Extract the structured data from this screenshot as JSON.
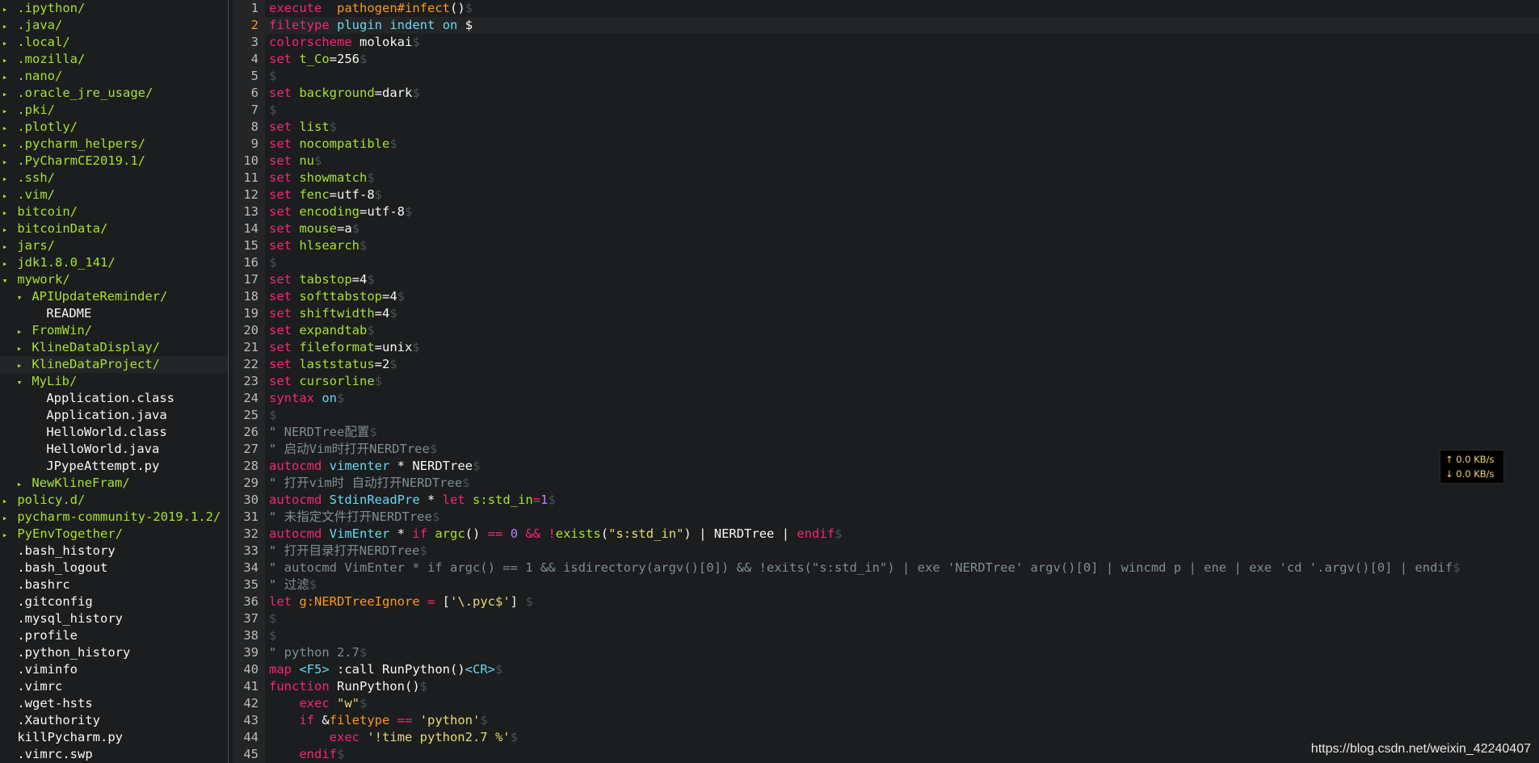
{
  "tree": {
    "current_index": 21,
    "items": [
      {
        "indent": 0,
        "arrow": "▸",
        "name": ".ipython",
        "slash": "/",
        "dir": true
      },
      {
        "indent": 0,
        "arrow": "▸",
        "name": ".java",
        "slash": "/",
        "dir": true
      },
      {
        "indent": 0,
        "arrow": "▸",
        "name": ".local",
        "slash": "/",
        "dir": true
      },
      {
        "indent": 0,
        "arrow": "▸",
        "name": ".mozilla",
        "slash": "/",
        "dir": true
      },
      {
        "indent": 0,
        "arrow": "▸",
        "name": ".nano",
        "slash": "/",
        "dir": true
      },
      {
        "indent": 0,
        "arrow": "▸",
        "name": ".oracle_jre_usage",
        "slash": "/",
        "dir": true
      },
      {
        "indent": 0,
        "arrow": "▸",
        "name": ".pki",
        "slash": "/",
        "dir": true
      },
      {
        "indent": 0,
        "arrow": "▸",
        "name": ".plotly",
        "slash": "/",
        "dir": true
      },
      {
        "indent": 0,
        "arrow": "▸",
        "name": ".pycharm_helpers",
        "slash": "/",
        "dir": true
      },
      {
        "indent": 0,
        "arrow": "▸",
        "name": ".PyCharmCE2019.1",
        "slash": "/",
        "dir": true
      },
      {
        "indent": 0,
        "arrow": "▸",
        "name": ".ssh",
        "slash": "/",
        "dir": true
      },
      {
        "indent": 0,
        "arrow": "▸",
        "name": ".vim",
        "slash": "/",
        "dir": true
      },
      {
        "indent": 0,
        "arrow": "▸",
        "name": "bitcoin",
        "slash": "/",
        "dir": true
      },
      {
        "indent": 0,
        "arrow": "▸",
        "name": "bitcoinData",
        "slash": "/",
        "dir": true
      },
      {
        "indent": 0,
        "arrow": "▸",
        "name": "jars",
        "slash": "/",
        "dir": true
      },
      {
        "indent": 0,
        "arrow": "▸",
        "name": "jdk1.8.0_141",
        "slash": "/",
        "dir": true
      },
      {
        "indent": 0,
        "arrow": "▾",
        "name": "mywork",
        "slash": "/",
        "dir": true
      },
      {
        "indent": 1,
        "arrow": "▾",
        "name": "APIUpdateReminder",
        "slash": "/",
        "dir": true
      },
      {
        "indent": 2,
        "arrow": "",
        "name": "README",
        "slash": "",
        "dir": false
      },
      {
        "indent": 1,
        "arrow": "▸",
        "name": "FromWin",
        "slash": "/",
        "dir": true
      },
      {
        "indent": 1,
        "arrow": "▸",
        "name": "KlineDataDisplay",
        "slash": "/",
        "dir": true
      },
      {
        "indent": 1,
        "arrow": "▸",
        "name": "KlineDataProject",
        "slash": "/",
        "dir": true
      },
      {
        "indent": 1,
        "arrow": "▾",
        "name": "MyLib",
        "slash": "/",
        "dir": true
      },
      {
        "indent": 2,
        "arrow": "",
        "name": "Application.class",
        "slash": "",
        "dir": false
      },
      {
        "indent": 2,
        "arrow": "",
        "name": "Application.java",
        "slash": "",
        "dir": false
      },
      {
        "indent": 2,
        "arrow": "",
        "name": "HelloWorld.class",
        "slash": "",
        "dir": false
      },
      {
        "indent": 2,
        "arrow": "",
        "name": "HelloWorld.java",
        "slash": "",
        "dir": false
      },
      {
        "indent": 2,
        "arrow": "",
        "name": "JPypeAttempt.py",
        "slash": "",
        "dir": false
      },
      {
        "indent": 1,
        "arrow": "▸",
        "name": "NewKlineFram",
        "slash": "/",
        "dir": true
      },
      {
        "indent": 0,
        "arrow": "▸",
        "name": "policy.d",
        "slash": "/",
        "dir": true
      },
      {
        "indent": 0,
        "arrow": "▸",
        "name": "pycharm-community-2019.1.2",
        "slash": "/",
        "dir": true
      },
      {
        "indent": 0,
        "arrow": "▸",
        "name": "PyEnvTogether",
        "slash": "/",
        "dir": true
      },
      {
        "indent": 0,
        "arrow": "",
        "name": ".bash_history",
        "slash": "",
        "dir": false
      },
      {
        "indent": 0,
        "arrow": "",
        "name": ".bash_logout",
        "slash": "",
        "dir": false
      },
      {
        "indent": 0,
        "arrow": "",
        "name": ".bashrc",
        "slash": "",
        "dir": false
      },
      {
        "indent": 0,
        "arrow": "",
        "name": ".gitconfig",
        "slash": "",
        "dir": false
      },
      {
        "indent": 0,
        "arrow": "",
        "name": ".mysql_history",
        "slash": "",
        "dir": false
      },
      {
        "indent": 0,
        "arrow": "",
        "name": ".profile",
        "slash": "",
        "dir": false
      },
      {
        "indent": 0,
        "arrow": "",
        "name": ".python_history",
        "slash": "",
        "dir": false
      },
      {
        "indent": 0,
        "arrow": "",
        "name": ".viminfo",
        "slash": "",
        "dir": false
      },
      {
        "indent": 0,
        "arrow": "",
        "name": ".vimrc",
        "slash": "",
        "dir": false
      },
      {
        "indent": 0,
        "arrow": "",
        "name": ".wget-hsts",
        "slash": "",
        "dir": false
      },
      {
        "indent": 0,
        "arrow": "",
        "name": ".Xauthority",
        "slash": "",
        "dir": false
      },
      {
        "indent": 0,
        "arrow": "",
        "name": "killPycharm.py",
        "slash": "",
        "dir": false
      },
      {
        "indent": 0,
        "arrow": "",
        "name": ".vimrc.swp",
        "slash": "",
        "dir": false
      }
    ]
  },
  "editor": {
    "current_line": 2,
    "lines": [
      [
        [
          "k",
          "execute"
        ],
        [
          "",
          "  "
        ],
        [
          "v",
          "pathogen#infect"
        ],
        [
          "",
          "()"
        ],
        [
          "eol",
          "$"
        ]
      ],
      [
        [
          "k",
          "filetype"
        ],
        [
          "",
          " "
        ],
        [
          "t",
          "plugin"
        ],
        [
          "",
          " "
        ],
        [
          "t",
          "indent"
        ],
        [
          "",
          " "
        ],
        [
          "t",
          "on"
        ],
        [
          "",
          " $"
        ]
      ],
      [
        [
          "k",
          "colorscheme"
        ],
        [
          "",
          " molokai"
        ],
        [
          "eol",
          "$"
        ]
      ],
      [
        [
          "k",
          "set"
        ],
        [
          "",
          " "
        ],
        [
          "g",
          "t_Co"
        ],
        [
          "",
          "=256"
        ],
        [
          "eol",
          "$"
        ]
      ],
      [
        [
          "eol",
          "$"
        ]
      ],
      [
        [
          "k",
          "set"
        ],
        [
          "",
          " "
        ],
        [
          "g",
          "background"
        ],
        [
          "",
          "=dark"
        ],
        [
          "eol",
          "$"
        ]
      ],
      [
        [
          "eol",
          "$"
        ]
      ],
      [
        [
          "k",
          "set"
        ],
        [
          "",
          " "
        ],
        [
          "g",
          "list"
        ],
        [
          "eol",
          "$"
        ]
      ],
      [
        [
          "k",
          "set"
        ],
        [
          "",
          " "
        ],
        [
          "g",
          "nocompatible"
        ],
        [
          "eol",
          "$"
        ]
      ],
      [
        [
          "k",
          "set"
        ],
        [
          "",
          " "
        ],
        [
          "g",
          "nu"
        ],
        [
          "eol",
          "$"
        ]
      ],
      [
        [
          "k",
          "set"
        ],
        [
          "",
          " "
        ],
        [
          "g",
          "showmatch"
        ],
        [
          "eol",
          "$"
        ]
      ],
      [
        [
          "k",
          "set"
        ],
        [
          "",
          " "
        ],
        [
          "g",
          "fenc"
        ],
        [
          "",
          "=utf-8"
        ],
        [
          "eol",
          "$"
        ]
      ],
      [
        [
          "k",
          "set"
        ],
        [
          "",
          " "
        ],
        [
          "g",
          "encoding"
        ],
        [
          "",
          "=utf-8"
        ],
        [
          "eol",
          "$"
        ]
      ],
      [
        [
          "k",
          "set"
        ],
        [
          "",
          " "
        ],
        [
          "g",
          "mouse"
        ],
        [
          "",
          "=a"
        ],
        [
          "eol",
          "$"
        ]
      ],
      [
        [
          "k",
          "set"
        ],
        [
          "",
          " "
        ],
        [
          "g",
          "hlsearch"
        ],
        [
          "eol",
          "$"
        ]
      ],
      [
        [
          "eol",
          "$"
        ]
      ],
      [
        [
          "k",
          "set"
        ],
        [
          "",
          " "
        ],
        [
          "g",
          "tabstop"
        ],
        [
          "",
          "=4"
        ],
        [
          "eol",
          "$"
        ]
      ],
      [
        [
          "k",
          "set"
        ],
        [
          "",
          " "
        ],
        [
          "g",
          "softtabstop"
        ],
        [
          "",
          "=4"
        ],
        [
          "eol",
          "$"
        ]
      ],
      [
        [
          "k",
          "set"
        ],
        [
          "",
          " "
        ],
        [
          "g",
          "shiftwidth"
        ],
        [
          "",
          "=4"
        ],
        [
          "eol",
          "$"
        ]
      ],
      [
        [
          "k",
          "set"
        ],
        [
          "",
          " "
        ],
        [
          "g",
          "expandtab"
        ],
        [
          "eol",
          "$"
        ]
      ],
      [
        [
          "k",
          "set"
        ],
        [
          "",
          " "
        ],
        [
          "g",
          "fileformat"
        ],
        [
          "",
          "=unix"
        ],
        [
          "eol",
          "$"
        ]
      ],
      [
        [
          "k",
          "set"
        ],
        [
          "",
          " "
        ],
        [
          "g",
          "laststatus"
        ],
        [
          "",
          "=2"
        ],
        [
          "eol",
          "$"
        ]
      ],
      [
        [
          "k",
          "set"
        ],
        [
          "",
          " "
        ],
        [
          "g",
          "cursorline"
        ],
        [
          "eol",
          "$"
        ]
      ],
      [
        [
          "k",
          "syntax"
        ],
        [
          "",
          " "
        ],
        [
          "t",
          "on"
        ],
        [
          "eol",
          "$"
        ]
      ],
      [
        [
          "eol",
          "$"
        ]
      ],
      [
        [
          "c",
          "\" NERDTree配置"
        ],
        [
          "eol",
          "$"
        ]
      ],
      [
        [
          "c",
          "\" 启动Vim时打开NERDTree"
        ],
        [
          "eol",
          "$"
        ]
      ],
      [
        [
          "k",
          "autocmd"
        ],
        [
          "",
          " "
        ],
        [
          "t",
          "vimenter"
        ],
        [
          "",
          " * NERDTree"
        ],
        [
          "eol",
          "$"
        ]
      ],
      [
        [
          "c",
          "\" 打开vim时 自动打开NERDTree"
        ],
        [
          "eol",
          "$"
        ]
      ],
      [
        [
          "k",
          "autocmd"
        ],
        [
          "",
          " "
        ],
        [
          "t",
          "StdinReadPre"
        ],
        [
          "",
          " * "
        ],
        [
          "k",
          "let"
        ],
        [
          "",
          " "
        ],
        [
          "g",
          "s:std_in"
        ],
        [
          "k",
          "="
        ],
        [
          "n",
          "1"
        ],
        [
          "eol",
          "$"
        ]
      ],
      [
        [
          "c",
          "\" 未指定文件打开NERDTree"
        ],
        [
          "eol",
          "$"
        ]
      ],
      [
        [
          "k",
          "autocmd"
        ],
        [
          "",
          " "
        ],
        [
          "t",
          "VimEnter"
        ],
        [
          "",
          " * "
        ],
        [
          "k",
          "if"
        ],
        [
          "",
          " "
        ],
        [
          "g",
          "argc"
        ],
        [
          "",
          "() "
        ],
        [
          "k",
          "=="
        ],
        [
          "",
          " "
        ],
        [
          "n",
          "0"
        ],
        [
          "",
          " "
        ],
        [
          "k",
          "&&"
        ],
        [
          "",
          " "
        ],
        [
          "k",
          "!"
        ],
        [
          "g",
          "exists"
        ],
        [
          "",
          "("
        ],
        [
          "s",
          "\"s:std_in\""
        ],
        [
          "",
          ") | NERDTree | "
        ],
        [
          "k",
          "endif"
        ],
        [
          "eol",
          "$"
        ]
      ],
      [
        [
          "c",
          "\" 打开目录打开NERDTree"
        ],
        [
          "eol",
          "$"
        ]
      ],
      [
        [
          "c",
          "\" autocmd VimEnter * if argc() == 1 && isdirectory(argv()[0]) && !exits(\"s:std_in\") | exe 'NERDTree' argv()[0] | wincmd p | ene | exe 'cd '.argv()[0] | endif"
        ],
        [
          "eol",
          "$"
        ]
      ],
      [
        [
          "c",
          "\" 过滤"
        ],
        [
          "eol",
          "$"
        ]
      ],
      [
        [
          "k",
          "let"
        ],
        [
          "",
          " "
        ],
        [
          "v",
          "g:NERDTreeIgnore"
        ],
        [
          "",
          " "
        ],
        [
          "k",
          "="
        ],
        [
          "",
          " ["
        ],
        [
          "s",
          "'\\.pyc$'"
        ],
        [
          "",
          "] "
        ],
        [
          "eol",
          "$"
        ]
      ],
      [
        [
          "eol",
          "$"
        ]
      ],
      [
        [
          "eol",
          "$"
        ]
      ],
      [
        [
          "c",
          "\" python 2.7"
        ],
        [
          "eol",
          "$"
        ]
      ],
      [
        [
          "k",
          "map"
        ],
        [
          "",
          " "
        ],
        [
          "t",
          "<F5>"
        ],
        [
          "",
          " :call RunPython()"
        ],
        [
          "t",
          "<CR>"
        ],
        [
          "eol",
          "$"
        ]
      ],
      [
        [
          "k",
          "function"
        ],
        [
          "",
          " RunPython"
        ],
        [
          "",
          "()"
        ],
        [
          "eol",
          "$"
        ]
      ],
      [
        [
          "",
          ""
        ],
        [
          "",
          "    "
        ],
        [
          "k",
          "exec"
        ],
        [
          "",
          " "
        ],
        [
          "s",
          "\"w\""
        ],
        [
          "eol",
          "$"
        ]
      ],
      [
        [
          "",
          "    "
        ],
        [
          "k",
          "if"
        ],
        [
          "",
          " &"
        ],
        [
          "v",
          "filetype"
        ],
        [
          "",
          " "
        ],
        [
          "k",
          "=="
        ],
        [
          "",
          " "
        ],
        [
          "s",
          "'python'"
        ],
        [
          "eol",
          "$"
        ]
      ],
      [
        [
          "",
          "        "
        ],
        [
          "k",
          "exec"
        ],
        [
          "",
          " "
        ],
        [
          "s",
          "'!time python2.7 %'"
        ],
        [
          "eol",
          "$"
        ]
      ],
      [
        [
          "",
          "    "
        ],
        [
          "k",
          "endif"
        ],
        [
          "eol",
          "$"
        ]
      ]
    ]
  },
  "netspeed": {
    "up": "↑ 0.0 KB/s",
    "down": "↓ 0.0 KB/s"
  },
  "watermark": "https://blog.csdn.net/weixin_42240407",
  "colors": {
    "background": "#1b1d1e",
    "keyword": "#f92672",
    "type": "#66d9ef",
    "string": "#e6db74",
    "comment": "#7e8e91",
    "number": "#ae81ff",
    "variable": "#fd971f",
    "directory": "#a6e22e"
  }
}
